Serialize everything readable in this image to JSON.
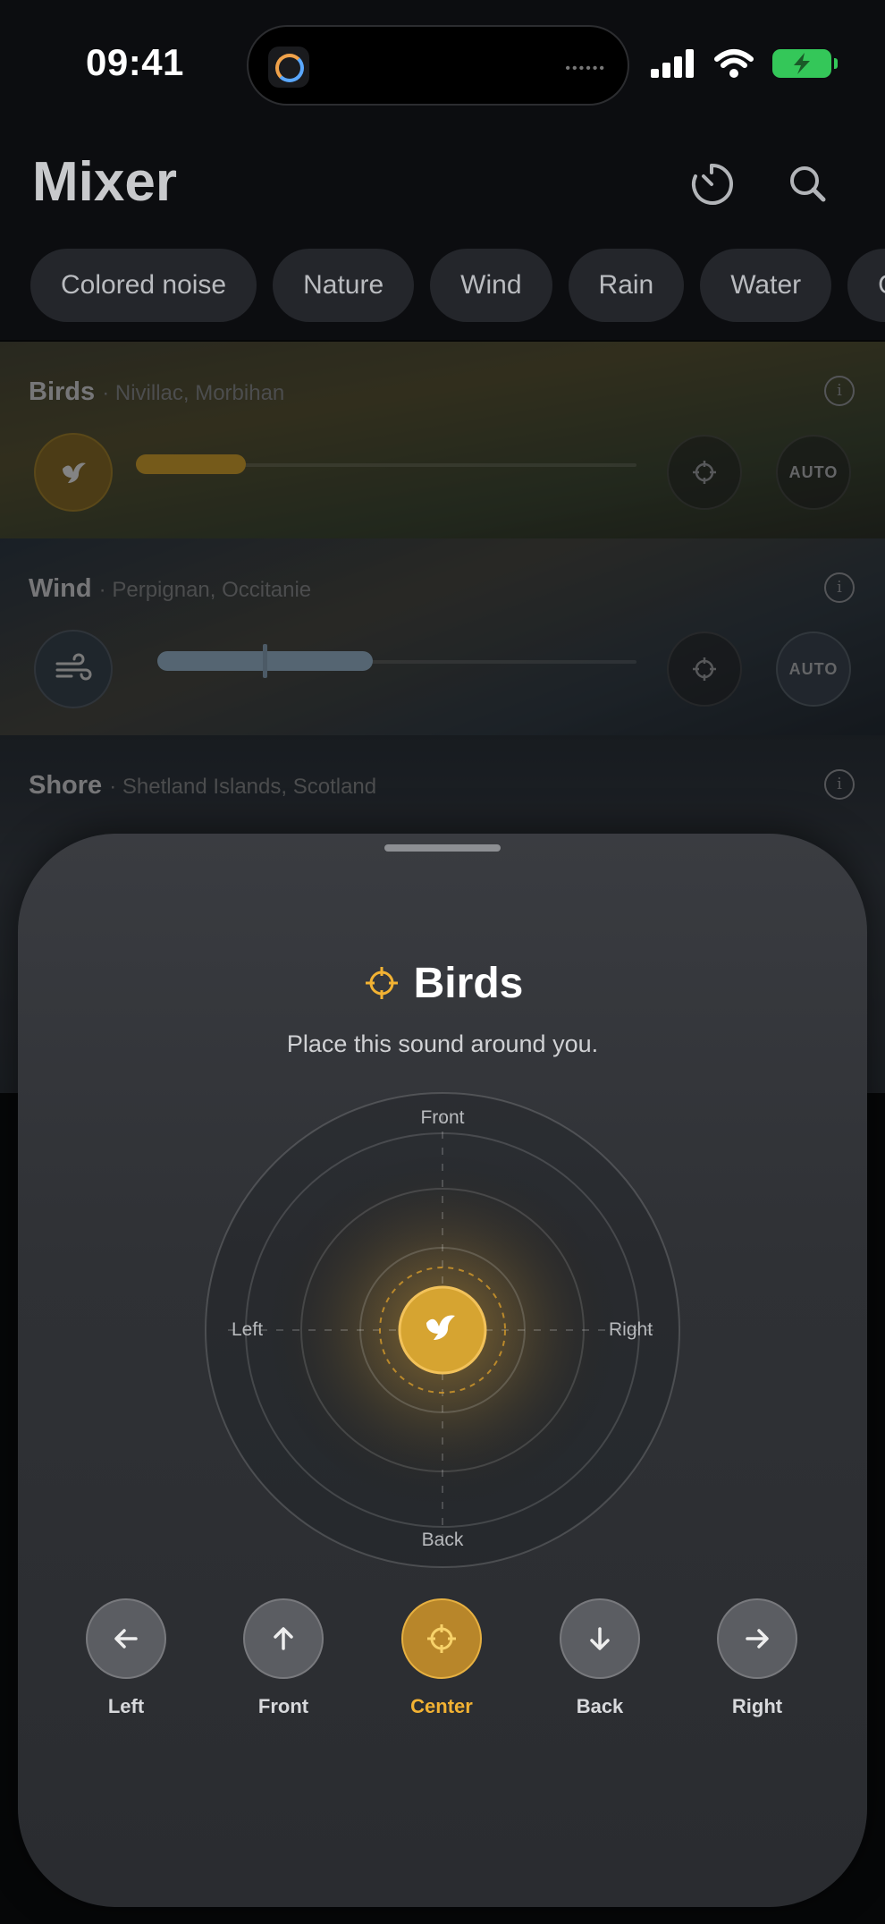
{
  "status": {
    "time": "09:41"
  },
  "header": {
    "title": "Mixer"
  },
  "categories": [
    "Colored noise",
    "Nature",
    "Wind",
    "Rain",
    "Water",
    "C"
  ],
  "mixer": [
    {
      "name": "Birds",
      "location": "Nivillac, Morbihan",
      "auto": "AUTO",
      "volume": 0.22,
      "color": "#d6a431"
    },
    {
      "name": "Wind",
      "location": "Perpignan, Occitanie",
      "auto": "AUTO",
      "volume": 0.45,
      "color": "#9cb8cf"
    },
    {
      "name": "Shore",
      "location": "Shetland Islands, Scotland"
    }
  ],
  "sheet": {
    "title": "Birds",
    "subtitle": "Place this sound around you.",
    "radar": {
      "front": "Front",
      "back": "Back",
      "left": "Left",
      "right": "Right"
    },
    "buttons": [
      {
        "label": "Left",
        "icon": "arrow-left-icon",
        "active": false
      },
      {
        "label": "Front",
        "icon": "arrow-up-icon",
        "active": false
      },
      {
        "label": "Center",
        "icon": "crosshair-icon",
        "active": true
      },
      {
        "label": "Back",
        "icon": "arrow-down-icon",
        "active": false
      },
      {
        "label": "Right",
        "icon": "arrow-right-icon",
        "active": false
      }
    ]
  },
  "colors": {
    "accent": "#f2b233",
    "accent_dark": "#b8862a"
  }
}
